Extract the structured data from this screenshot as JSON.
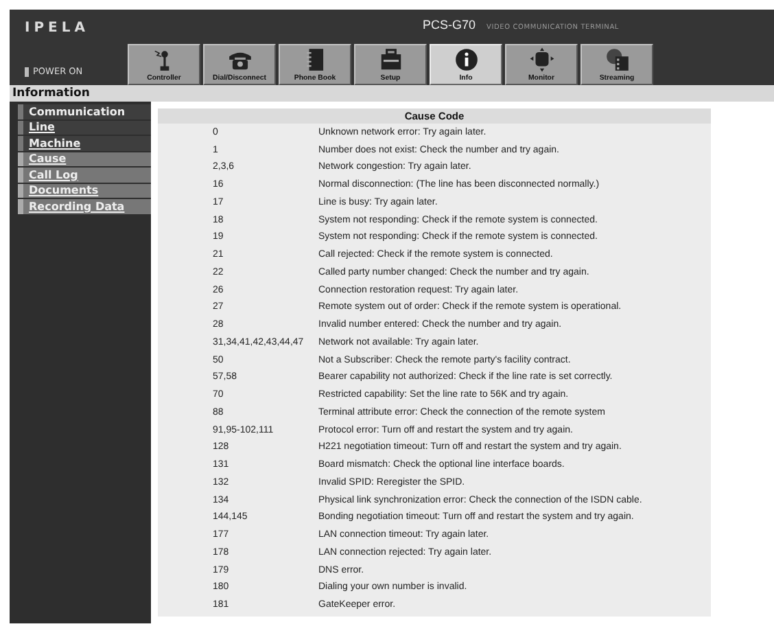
{
  "header": {
    "logo": "IPELA",
    "model": "PCS-G70",
    "subtitle": "VIDEO COMMUNICATION TERMINAL",
    "power": "POWER ON"
  },
  "toolbar": [
    {
      "label": "Controller",
      "kind": "joystick",
      "selected": false
    },
    {
      "label": "Dial/Disconnect",
      "kind": "phone",
      "selected": false
    },
    {
      "label": "Phone Book",
      "kind": "book",
      "selected": false
    },
    {
      "label": "Setup",
      "kind": "toolbox",
      "selected": false
    },
    {
      "label": "Info",
      "kind": "info",
      "selected": true
    },
    {
      "label": "Monitor",
      "kind": "monitor",
      "selected": false
    },
    {
      "label": "Streaming",
      "kind": "streaming",
      "selected": false
    }
  ],
  "section_title": "Information",
  "sidebar": {
    "items": [
      {
        "label": "Communication",
        "kind": "heading",
        "shaded": false
      },
      {
        "label": "Line",
        "kind": "link",
        "shaded": false
      },
      {
        "label": "Machine",
        "kind": "link",
        "shaded": false
      },
      {
        "label": "Cause",
        "kind": "link",
        "shaded": true
      },
      {
        "label": "Call Log",
        "kind": "link",
        "shaded": true
      },
      {
        "label": "Documents",
        "kind": "link",
        "shaded": true
      },
      {
        "label": "Recording Data",
        "kind": "link",
        "shaded": true
      }
    ]
  },
  "table": {
    "title": "Cause Code",
    "rows": [
      [
        "0",
        "Unknown network error: Try again later."
      ],
      [
        "1",
        "Number does not exist: Check the number and try again."
      ],
      [
        "2,3,6",
        "Network congestion: Try again later."
      ],
      [
        "16",
        "Normal disconnection: (The line has been disconnected normally.)"
      ],
      [
        "17",
        "Line is busy: Try again later."
      ],
      [
        "18",
        "System not responding: Check if the remote system is connected."
      ],
      [
        "19",
        "System not responding: Check if the remote system is connected."
      ],
      [
        "21",
        "Call rejected: Check if the remote system is connected."
      ],
      [
        "22",
        "Called party number changed: Check the number and try again."
      ],
      [
        "26",
        "Connection restoration request: Try again later."
      ],
      [
        "27",
        "Remote system out of order: Check  if the remote system is operational."
      ],
      [
        "28",
        "Invalid number entered: Check the number and try again."
      ],
      [
        "31,34,41,42,43,44,47",
        "Network not available: Try again later."
      ],
      [
        "50",
        "Not a Subscriber: Check the remote party's facility contract."
      ],
      [
        "57,58",
        "Bearer capability not authorized: Check if the line rate is set correctly."
      ],
      [
        "70",
        "Restricted capability: Set the line rate to 56K and try again."
      ],
      [
        "88",
        "Terminal attribute error: Check the connection of the remote system"
      ],
      [
        "91,95-102,111",
        "Protocol error: Turn off and restart the system and try again."
      ],
      [
        "128",
        "H221 negotiation timeout: Turn off and restart the system and try again."
      ],
      [
        "131",
        "Board mismatch: Check the optional line interface boards."
      ],
      [
        "132",
        "Invalid SPID: Reregister the SPID."
      ],
      [
        "134",
        "Physical link synchronization error: Check the connection of the ISDN cable."
      ],
      [
        "144,145",
        "Bonding negotiation timeout: Turn off and restart the system and try again."
      ],
      [
        "177",
        "LAN connection timeout: Try again later."
      ],
      [
        "178",
        "LAN connection rejected: Try again later."
      ],
      [
        "179",
        "DNS error."
      ],
      [
        "180",
        "Dialing your own number is invalid."
      ],
      [
        "181",
        "GateKeeper error."
      ]
    ]
  }
}
